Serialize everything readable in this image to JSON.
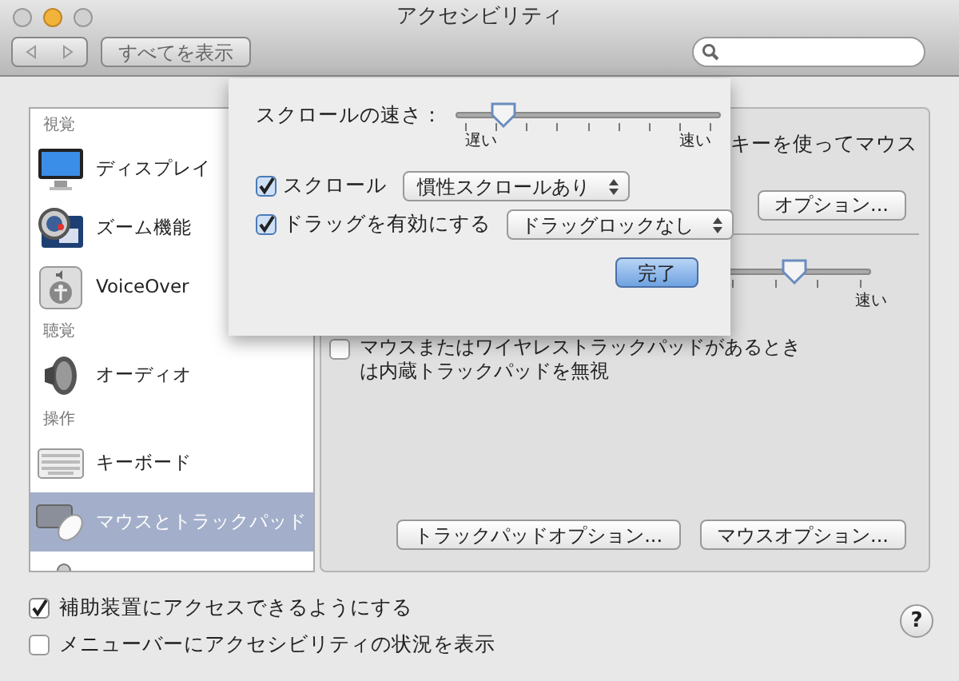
{
  "window": {
    "title": "アクセシビリティ"
  },
  "toolbar": {
    "show_all": "すべてを表示"
  },
  "sidebar": {
    "items": [
      {
        "kind": "header",
        "label": "視覚"
      },
      {
        "kind": "item",
        "label": "ディスプレイ",
        "selected": false
      },
      {
        "kind": "item",
        "label": "ズーム機能",
        "selected": false
      },
      {
        "kind": "item",
        "label": "VoiceOver",
        "selected": false
      },
      {
        "kind": "header",
        "label": "聴覚"
      },
      {
        "kind": "item",
        "label": "オーディオ",
        "selected": false
      },
      {
        "kind": "header",
        "label": "操作"
      },
      {
        "kind": "item",
        "label": "キーボード",
        "selected": false
      },
      {
        "kind": "item",
        "label": "マウスとトラックパッド",
        "selected": true
      },
      {
        "kind": "partial"
      }
    ]
  },
  "panel": {
    "mousekeys_text": "キーを使ってマウス",
    "options_button": "オプション...",
    "double_click": {
      "level": 0.76,
      "max_label": "速い"
    },
    "ignore_trackpad": {
      "label": "マウスまたはワイヤレストラックパッドがあるときは内蔵トラックパッドを無視",
      "checked": false
    },
    "buttons": [
      "トラックパッドオプション...",
      "マウスオプション..."
    ]
  },
  "sheet": {
    "scroll_speed": {
      "label": "スクロールの速さ：",
      "level": 0.18,
      "min_label": "遅い",
      "max_label": "速い"
    },
    "options": [
      {
        "label": "スクロール",
        "checked": true,
        "popup": "慣性スクロールあり"
      },
      {
        "label": "ドラッグを有効にする",
        "checked": true,
        "popup": "ドラッグロックなし"
      }
    ],
    "done_button": "完了"
  },
  "footer": {
    "checkboxes": [
      {
        "label": "補助装置にアクセスできるようにする",
        "checked": true
      },
      {
        "label": "メニューバーにアクセシビリティの状況を表示",
        "checked": false
      }
    ],
    "help": "?"
  }
}
